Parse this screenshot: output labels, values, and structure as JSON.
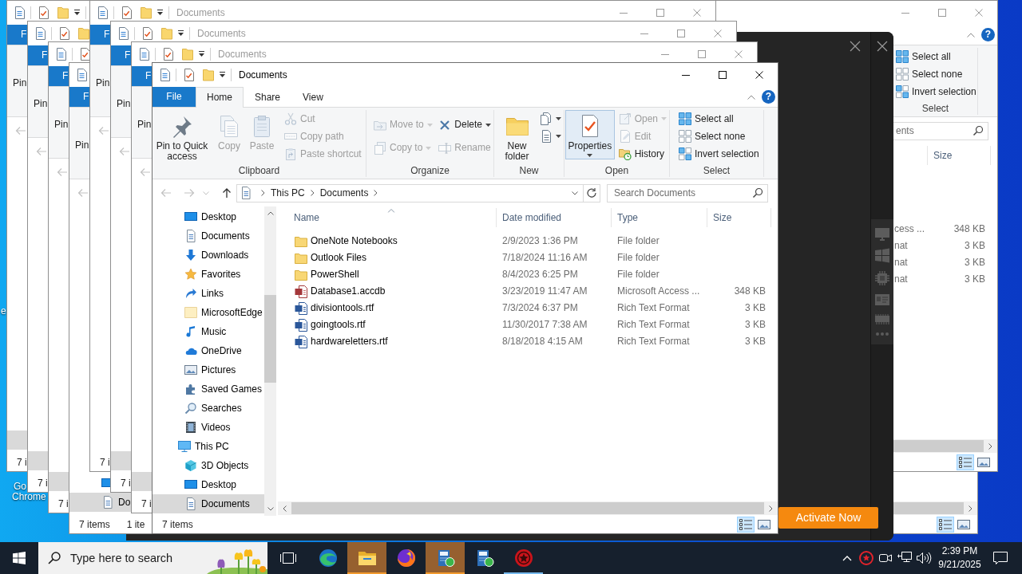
{
  "desktop_icons": [
    {
      "lines": [
        "e"
      ]
    },
    {
      "lines": [
        "Go",
        "Chrome"
      ]
    }
  ],
  "background_windows": [
    {
      "kind": "explorer",
      "view_buttons": [
        {
          "selected": true
        },
        {
          "selected": false
        }
      ]
    },
    {
      "kind": "explorer",
      "active": false,
      "help": "?",
      "select_group": {
        "commands": [
          "Select all",
          "Select none",
          "Invert selection"
        ],
        "label": "Select"
      },
      "search": {
        "placeholder": "ents"
      },
      "columns": [
        "Size"
      ],
      "rows": [
        {
          "type": "cess ...",
          "size": "348 KB"
        },
        {
          "type": "nat",
          "size": "3 KB"
        },
        {
          "type": "nat",
          "size": "3 KB"
        },
        {
          "type": "nat",
          "size": "3 KB"
        }
      ],
      "view_buttons": [
        {
          "selected": true
        },
        {
          "selected": false
        }
      ]
    },
    {
      "kind": "app",
      "action": "Activate Now"
    },
    {
      "kind": "explorer",
      "file_tab": "F",
      "ribbon_text": "Pin",
      "nav_buttons": [
        {
          "disabled": true
        }
      ],
      "nav_items": [
        {
          "selected": true
        }
      ],
      "status": "7 i"
    },
    {
      "kind": "explorer",
      "file_tab": "F",
      "ribbon_text": "Pin",
      "nav_buttons": [
        {
          "disabled": true
        }
      ],
      "nav_items": [
        {
          "selected": true
        }
      ],
      "status": "7 i"
    },
    {
      "kind": "explorer",
      "file_tab": "F",
      "ribbon_text": "Pin",
      "nav_buttons": [
        {
          "disabled": true
        }
      ],
      "nav_items": [
        {
          "selected": true
        }
      ],
      "status": "7 i"
    },
    {
      "kind": "explorer",
      "file_tab": "F",
      "ribbon_text": "Pin",
      "nav_buttons": [
        {
          "disabled": true
        }
      ],
      "nav_items": [
        {
          "selected": false
        },
        {
          "label": "Do",
          "selected": true
        }
      ],
      "status": "7 items",
      "selection_status": "1 ite"
    },
    {
      "kind": "explorer",
      "active": false,
      "title": "Documents",
      "file_tab": "F",
      "ribbon_text": "Pin",
      "nav_buttons": [
        {
          "disabled": true
        }
      ],
      "status": "7 i"
    },
    {
      "kind": "explorer",
      "active": false,
      "title": "Documents",
      "file_tab": "F",
      "ribbon_text": "Pin",
      "nav_buttons": [
        {
          "disabled": true
        }
      ],
      "nav_items": [
        {
          "selected": true
        }
      ],
      "status": "7 i"
    },
    {
      "kind": "explorer",
      "active": false,
      "title": "Documents",
      "file_tab": "F",
      "ribbon_text": "Pin",
      "nav_buttons": [
        {
          "disabled": true
        }
      ],
      "nav_items": [
        {
          "selected": true
        }
      ],
      "status": "7 i"
    }
  ],
  "window": {
    "active": true,
    "title": "Documents",
    "help": "?",
    "tabs": [
      {
        "label": "File",
        "kind": "menu",
        "selected": false
      },
      {
        "label": "Home",
        "kind": "tab",
        "selected": true
      },
      {
        "label": "Share",
        "kind": "tab",
        "selected": false
      },
      {
        "label": "View",
        "kind": "tab",
        "selected": false
      }
    ],
    "ribbon_groups": [
      {
        "label": "Clipboard",
        "commands": [
          {
            "label": "Pin to Quick access",
            "kind": "large",
            "disabled": false,
            "dropdown": false,
            "hovered": false
          },
          {
            "label": "Copy",
            "kind": "large",
            "disabled": true,
            "dropdown": false,
            "hovered": false
          },
          {
            "label": "Paste",
            "kind": "large",
            "disabled": true,
            "dropdown": false,
            "hovered": false
          },
          {
            "label": "Cut",
            "kind": "small",
            "disabled": true,
            "dropdown": false,
            "hovered": false
          },
          {
            "label": "Copy path",
            "kind": "small",
            "disabled": true,
            "dropdown": false,
            "hovered": false
          },
          {
            "label": "Paste shortcut",
            "kind": "small",
            "disabled": true,
            "dropdown": false,
            "hovered": false
          }
        ]
      },
      {
        "label": "Organize",
        "commands": [
          {
            "label": "Move to",
            "kind": "medium",
            "disabled": true,
            "dropdown": true,
            "hovered": false
          },
          {
            "label": "Copy to",
            "kind": "medium",
            "disabled": true,
            "dropdown": true,
            "hovered": false
          },
          {
            "label": "Delete",
            "kind": "medium",
            "disabled": false,
            "dropdown": true,
            "hovered": false
          },
          {
            "label": "Rename",
            "kind": "medium",
            "disabled": true,
            "dropdown": false,
            "hovered": false
          }
        ]
      },
      {
        "label": "New",
        "commands": [
          {
            "label": "New folder",
            "kind": "large",
            "disabled": false,
            "dropdown": false,
            "hovered": false
          },
          {
            "kind": "small",
            "disabled": false,
            "dropdown": true,
            "hovered": false
          },
          {
            "kind": "small",
            "disabled": false,
            "dropdown": true,
            "hovered": false
          }
        ]
      },
      {
        "label": "Open",
        "commands": [
          {
            "label": "Properties",
            "kind": "large",
            "disabled": false,
            "dropdown": true,
            "hovered": true
          },
          {
            "label": "Open",
            "kind": "small",
            "disabled": true,
            "dropdown": true,
            "hovered": false
          },
          {
            "label": "Edit",
            "kind": "small",
            "disabled": true,
            "dropdown": false,
            "hovered": false
          },
          {
            "label": "History",
            "kind": "small",
            "disabled": false,
            "dropdown": false,
            "hovered": false
          }
        ]
      },
      {
        "label": "Select",
        "commands": [
          {
            "label": "Select all",
            "kind": "small",
            "disabled": false,
            "dropdown": false,
            "hovered": false
          },
          {
            "label": "Select none",
            "kind": "small",
            "disabled": false,
            "dropdown": false,
            "hovered": false
          },
          {
            "label": "Invert selection",
            "kind": "small",
            "disabled": false,
            "dropdown": false,
            "hovered": false
          }
        ]
      }
    ],
    "nav_buttons": [
      {
        "disabled": true
      },
      {
        "disabled": true
      },
      {
        "disabled": true
      },
      {
        "disabled": false
      }
    ],
    "address": {
      "segments": [
        "This PC",
        "Documents"
      ]
    },
    "search": {
      "placeholder": "Search Documents"
    },
    "navigation_pane": {
      "tree": [
        {
          "children": [
            {
              "label": "Desktop",
              "selected": false
            },
            {
              "label": "Documents",
              "selected": false
            },
            {
              "label": "Downloads",
              "selected": false
            },
            {
              "label": "Favorites",
              "selected": false
            },
            {
              "label": "Links",
              "selected": false
            },
            {
              "label": "MicrosoftEdge",
              "selected": false
            },
            {
              "label": "Music",
              "selected": false
            },
            {
              "label": "OneDrive",
              "selected": false
            },
            {
              "label": "Pictures",
              "selected": false
            },
            {
              "label": "Saved Games",
              "selected": false
            },
            {
              "label": "Searches",
              "selected": false
            },
            {
              "label": "Videos",
              "selected": false
            }
          ]
        },
        {
          "label": "This PC",
          "selected": false,
          "children": [
            {
              "label": "3D Objects",
              "selected": false
            },
            {
              "label": "Desktop",
              "selected": false
            },
            {
              "label": "Documents",
              "selected": true
            }
          ]
        }
      ]
    },
    "columns": [
      {
        "label": "Name",
        "sorted": true
      },
      {
        "label": "Date modified",
        "sorted": false
      },
      {
        "label": "Type",
        "sorted": false
      },
      {
        "label": "Size",
        "sorted": false
      }
    ],
    "rows": [
      {
        "name": "OneNote Notebooks",
        "date_modified": "2/9/2023 1:36 PM",
        "type": "File folder",
        "selected": false
      },
      {
        "name": "Outlook Files",
        "date_modified": "7/18/2024 11:16 AM",
        "type": "File folder",
        "selected": false
      },
      {
        "name": "PowerShell",
        "date_modified": "8/4/2023 6:25 PM",
        "type": "File folder",
        "selected": false
      },
      {
        "name": "Database1.accdb",
        "date_modified": "3/23/2019 11:47 AM",
        "type": "Microsoft Access ...",
        "size": "348 KB",
        "selected": false
      },
      {
        "name": "divisiontools.rtf",
        "date_modified": "7/3/2024 6:37 PM",
        "type": "Rich Text Format",
        "size": "3 KB",
        "selected": false
      },
      {
        "name": "goingtools.rtf",
        "date_modified": "11/30/2017 7:38 AM",
        "type": "Rich Text Format",
        "size": "3 KB",
        "selected": false
      },
      {
        "name": "hardwareletters.rtf",
        "date_modified": "8/18/2018 4:15 AM",
        "type": "Rich Text Format",
        "size": "3 KB",
        "selected": false
      }
    ],
    "status": "7 items",
    "view_buttons": [
      {
        "selected": true
      },
      {
        "selected": false
      }
    ]
  },
  "taskbar": {
    "search": {
      "placeholder": "Type here to search"
    },
    "apps": [
      {
        "flashing": false,
        "running": false
      },
      {
        "flashing": true,
        "running": false
      },
      {
        "flashing": false,
        "running": false
      },
      {
        "flashing": true,
        "running": false
      },
      {
        "flashing": false,
        "running": false
      },
      {
        "flashing": false,
        "running": true
      }
    ],
    "clock": {
      "time": "2:39 PM",
      "date": "9/21/2025"
    }
  }
}
